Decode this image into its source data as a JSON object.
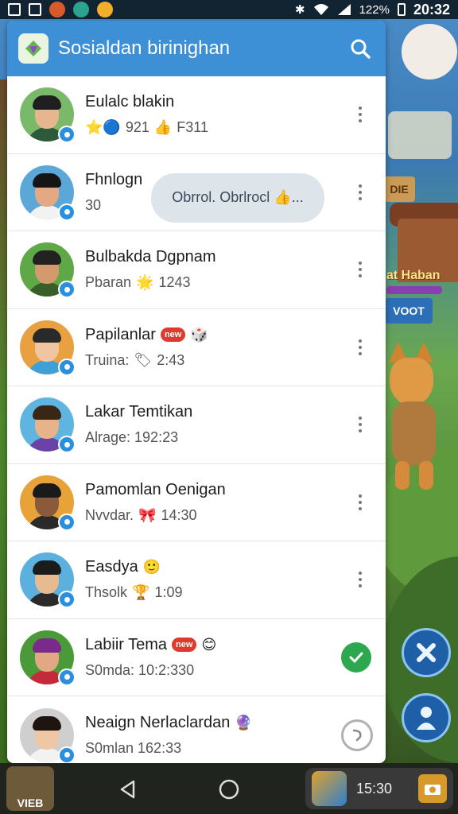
{
  "status_bar": {
    "battery": "122%",
    "time": "20:32"
  },
  "app": {
    "title": "Sosialdan birinighan"
  },
  "background": {
    "sign_text": "DIE",
    "banner_text": "at Haban",
    "label_text": "VOOT"
  },
  "contacts": [
    {
      "name": "Eulalc blakin",
      "sub": "921 F311",
      "sub_prefix_emoji": "⭐🔵",
      "sub_mid_emoji": "👍",
      "action": "more",
      "colors": {
        "skin": "#e7b58f",
        "hair": "#1f1f1f",
        "shirt": "#2d5a3a",
        "bg": "#7ab86a"
      }
    },
    {
      "name": "Fhnlogn",
      "sub": "30",
      "action": "more",
      "tooltip": "Obrrol. Obrlrocl 👍...",
      "colors": {
        "skin": "#e3a984",
        "hair": "#151515",
        "shirt": "#f2f2f2",
        "bg": "#5aa7d8"
      }
    },
    {
      "name": "Bulbakda Dgpnam",
      "sub": "Pbaran",
      "sub_emoji": "🌟",
      "sub_tail": "1243",
      "action": "more",
      "colors": {
        "skin": "#d39a6e",
        "hair": "#222",
        "shirt": "#3a5e2a",
        "bg": "#5fa847"
      }
    },
    {
      "name": "Papilanlar",
      "name_tag": "new",
      "name_emoji": "🎲",
      "sub": "Truina:",
      "sub_emoji": "🏷",
      "sub_tail": "2:43",
      "action": "more",
      "colors": {
        "skin": "#f0c6a0",
        "hair": "#2a2a2a",
        "shirt": "#3fa0d8",
        "bg": "#e8a040"
      }
    },
    {
      "name": "Lakar Temtikan",
      "sub": "Alrage: 192:23",
      "action": "more",
      "colors": {
        "skin": "#e8b28a",
        "hair": "#3a2614",
        "shirt": "#6b42a8",
        "bg": "#5fb5e0"
      }
    },
    {
      "name": "Pamomlan Oenigan",
      "sub": "Nvvdar.",
      "sub_emoji": "🎀",
      "sub_tail": "14:30",
      "action": "more",
      "colors": {
        "skin": "#8a5a3a",
        "hair": "#1a1a1a",
        "shirt": "#2a2a2a",
        "bg": "#e8a338"
      }
    },
    {
      "name": "Easdya",
      "name_emoji": "🙂",
      "sub": "Thsolk",
      "sub_emoji": "🏆",
      "sub_tail": "1:09",
      "action": "more",
      "colors": {
        "skin": "#e8ba90",
        "hair": "#1c1c1c",
        "shirt": "#2a2a2a",
        "bg": "#5cb0de"
      }
    },
    {
      "name": "Labiir Tema",
      "name_tag": "new",
      "name_emoji": "😊",
      "sub": "S0mda: 10:2:330",
      "action": "check",
      "colors": {
        "skin": "#e2a884",
        "hair": "#7a2a8a",
        "shirt": "#c32a3a",
        "bg": "#4a9a3a"
      }
    },
    {
      "name": "Neaign Nerlaclardan",
      "name_emoji": "🔮",
      "sub": "S0mlan 162:33",
      "action": "refresh",
      "colors": {
        "skin": "#efc7a5",
        "hair": "#1e1410",
        "shirt": "#f2f2f2",
        "bg": "#cfcfcf"
      }
    }
  ],
  "nav": {
    "left_thumb_label": "VIEB",
    "right_time": "15:30"
  },
  "theme": {
    "header_blue": "#3d8fd6",
    "check_green": "#2ea84f",
    "badge_blue": "#2b8fe0"
  }
}
